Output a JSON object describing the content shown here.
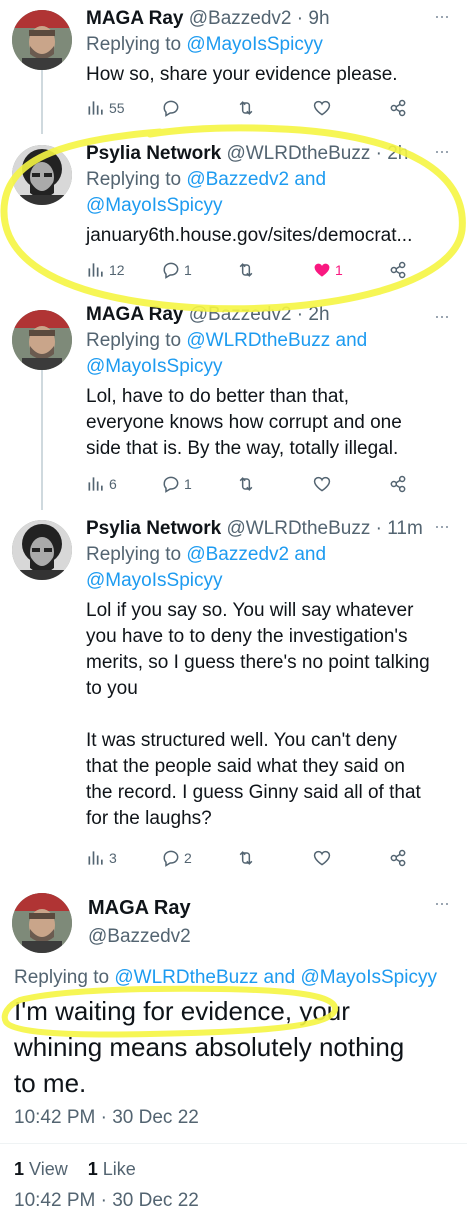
{
  "tweets": [
    {
      "name": "MAGA Ray",
      "handle": "@Bazzedv2",
      "time": "9h",
      "reply_prefix": "Replying to ",
      "reply_to_1": "@MayoIsSpicyy",
      "text_lines": [
        "How so, share your evidence please."
      ],
      "views": "55",
      "replies": "",
      "likes": ""
    },
    {
      "name": "Psylia Network",
      "handle": "@WLRDtheBuzz",
      "time": "2h",
      "reply_prefix": "Replying to ",
      "reply_to_1": "@Bazzedv2 and",
      "reply_to_2": "@MayoIsSpicyy",
      "link": "january6th.house.gov/sites/democrat...",
      "views": "12",
      "replies": "1",
      "likes": "1"
    },
    {
      "name": "MAGA Ray",
      "handle": "@Bazzedv2",
      "time": "2h",
      "reply_prefix": "Replying to ",
      "reply_to_1": "@WLRDtheBuzz and",
      "reply_to_2": "@MayoIsSpicyy",
      "text_lines": [
        "Lol, have to do better than that,",
        "everyone knows how corrupt and one",
        "side that is. By the way, totally illegal."
      ],
      "views": "6",
      "replies": "1",
      "likes": ""
    },
    {
      "name": "Psylia Network",
      "handle": "@WLRDtheBuzz",
      "time": "11m",
      "reply_prefix": "Replying to ",
      "reply_to_1": "@Bazzedv2 and",
      "reply_to_2": "@MayoIsSpicyy",
      "text_lines": [
        "Lol if you say so. You will say whatever",
        "you have to to deny the investigation's",
        "merits, so I guess there's no point talking",
        "to you",
        "",
        "It was structured well. You can't deny",
        "that the people said what they said on",
        "the record. I guess Ginny said all of that",
        "for the laughs?"
      ],
      "views": "3",
      "replies": "2",
      "likes": ""
    }
  ],
  "main_tweet": {
    "name": "MAGA Ray",
    "handle": "@Bazzedv2",
    "reply_prefix": "Replying to ",
    "reply_to": "@WLRDtheBuzz and @MayoIsSpicyy",
    "text_lines": [
      "I'm waiting for evidence, your",
      "whining means absolutely nothing",
      "to me."
    ],
    "timestamp": "10:42 PM · 30 Dec 22",
    "views_count": "1",
    "views_label": "View",
    "likes_count": "1",
    "likes_label": "Like",
    "cutoff_text": "10:42 PM · 30 Dec 22"
  },
  "separator": " · ",
  "colors": {
    "link": "#1d9bf0",
    "secondary": "#536471",
    "like_active": "#f91880",
    "highlight": "#f5f542"
  },
  "icons": [
    "views-icon",
    "reply-icon",
    "retweet-icon",
    "like-icon",
    "share-icon",
    "more-icon"
  ]
}
